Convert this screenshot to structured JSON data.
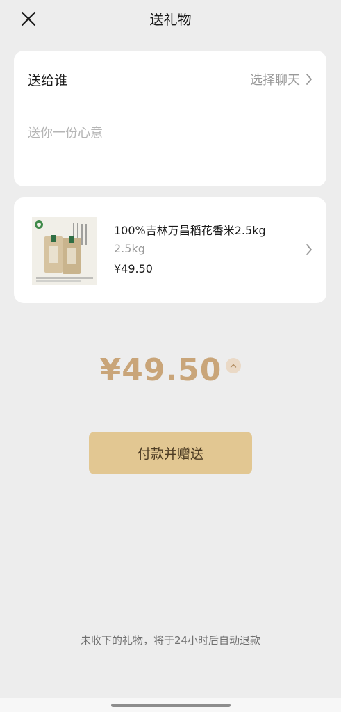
{
  "header": {
    "title": "送礼物",
    "close_icon": "close-icon"
  },
  "recipient": {
    "label": "送给谁",
    "action": "选择聊天",
    "chevron_icon": "chevron-right-icon"
  },
  "message": {
    "placeholder": "送你一份心意",
    "value": ""
  },
  "product": {
    "name": "100%吉林万昌稻花香米2.5kg",
    "spec": "2.5kg",
    "price": "¥49.50",
    "image_icon": "rice-bag-image",
    "chevron_icon": "chevron-right-icon"
  },
  "total": {
    "amount": "¥49.50",
    "toggle_icon": "chevron-up-icon"
  },
  "pay_button": {
    "label": "付款并赠送"
  },
  "notice": {
    "text": "未收下的礼物，将于24小时后自动退款"
  },
  "colors": {
    "background": "#ededed",
    "card": "#ffffff",
    "accent_gold": "#c9a579",
    "button_fill": "#e2c792",
    "button_text": "#4d3c24",
    "muted_text": "#9a9a9a"
  }
}
